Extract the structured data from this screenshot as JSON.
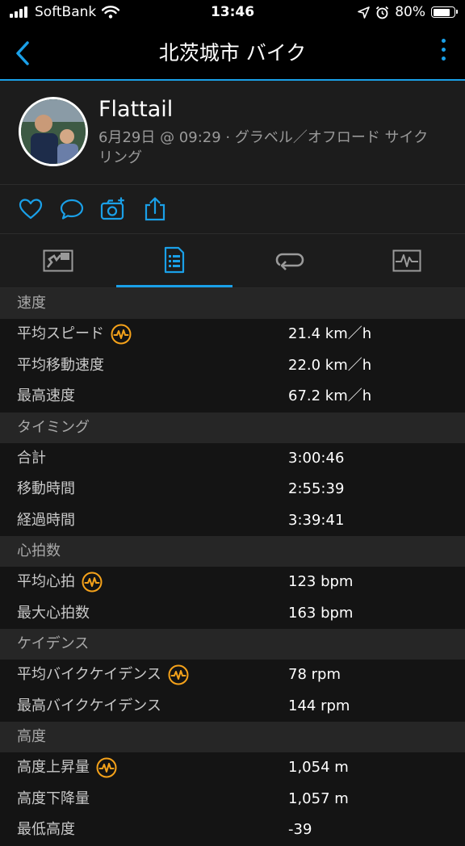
{
  "status_bar": {
    "carrier": "SoftBank",
    "time": "13:46",
    "battery": "80%",
    "battery_level": 0.8
  },
  "nav": {
    "title": "北茨城市 バイク"
  },
  "profile": {
    "name": "Flattail",
    "meta": "6月29日 @ 09:29 · グラベル／オフロード サイクリング"
  },
  "colors": {
    "accent": "#1aa0e8",
    "badge": "#f5a21a"
  },
  "sections": [
    {
      "title": "速度",
      "rows": [
        {
          "label": "平均スピード",
          "value": "21.4 km／h",
          "badge": true
        },
        {
          "label": "平均移動速度",
          "value": "22.0 km／h",
          "badge": false
        },
        {
          "label": "最高速度",
          "value": "67.2 km／h",
          "badge": false
        }
      ]
    },
    {
      "title": "タイミング",
      "rows": [
        {
          "label": "合計",
          "value": "3:00:46",
          "badge": false
        },
        {
          "label": "移動時間",
          "value": "2:55:39",
          "badge": false
        },
        {
          "label": "経過時間",
          "value": "3:39:41",
          "badge": false
        }
      ]
    },
    {
      "title": "心拍数",
      "rows": [
        {
          "label": "平均心拍",
          "value": "123 bpm",
          "badge": true
        },
        {
          "label": "最大心拍数",
          "value": "163 bpm",
          "badge": false
        }
      ]
    },
    {
      "title": "ケイデンス",
      "rows": [
        {
          "label": "平均バイクケイデンス",
          "value": "78 rpm",
          "badge": true
        },
        {
          "label": "最高バイクケイデンス",
          "value": "144 rpm",
          "badge": false
        }
      ]
    },
    {
      "title": "高度",
      "rows": [
        {
          "label": "高度上昇量",
          "value": "1,054 m",
          "badge": true
        },
        {
          "label": "高度下降量",
          "value": "1,057 m",
          "badge": false
        },
        {
          "label": "最低高度",
          "value": "-39",
          "badge": false
        }
      ]
    }
  ]
}
